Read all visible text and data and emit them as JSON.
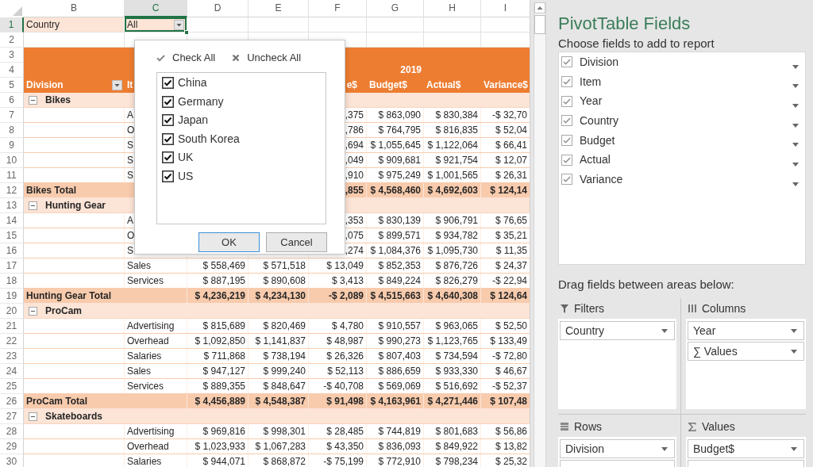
{
  "sheet": {
    "columns": [
      {
        "letter": "B",
        "selected": false
      },
      {
        "letter": "C",
        "selected": true
      },
      {
        "letter": "D",
        "selected": false
      },
      {
        "letter": "E",
        "selected": false
      },
      {
        "letter": "F",
        "selected": false
      },
      {
        "letter": "G",
        "selected": false
      },
      {
        "letter": "H",
        "selected": false
      },
      {
        "letter": "I",
        "selected": false
      }
    ],
    "rows": [
      {
        "number": "1",
        "selected": true,
        "kind": "filter",
        "cells": {
          "b": "Country",
          "c": "All"
        }
      },
      {
        "number": "2",
        "selected": false,
        "kind": "blank"
      },
      {
        "number": "3",
        "selected": false,
        "kind": "band"
      },
      {
        "number": "4",
        "selected": false,
        "kind": "band_years",
        "cells": {
          "g": "2019"
        }
      },
      {
        "number": "5",
        "selected": false,
        "kind": "band_labels",
        "filter_button": true,
        "cells": {
          "b": "Division",
          "c": "It",
          "f": "e$",
          "g": "Budget$",
          "h": "Actual$",
          "i": "Variance$"
        }
      },
      {
        "number": "6",
        "selected": false,
        "kind": "group",
        "expanded": true,
        "cells": {
          "b": "Bikes"
        }
      },
      {
        "number": "7",
        "selected": false,
        "kind": "item",
        "cells": {
          "c": "A",
          "f": ",375",
          "g": "$ 863,090",
          "h": "$ 830,384",
          "i": "-$ 32,70"
        }
      },
      {
        "number": "8",
        "selected": false,
        "kind": "item",
        "cells": {
          "c": "O",
          "f": ",786",
          "g": "$ 764,795",
          "h": "$ 816,835",
          "i": "$ 52,04"
        }
      },
      {
        "number": "9",
        "selected": false,
        "kind": "item",
        "cells": {
          "c": "S",
          "f": ",694",
          "g": "$ 1,055,645",
          "h": "$ 1,122,064",
          "i": "$ 66,41"
        }
      },
      {
        "number": "10",
        "selected": false,
        "kind": "item",
        "cells": {
          "c": "S",
          "f": ",049",
          "g": "$ 909,681",
          "h": "$ 921,754",
          "i": "$ 12,07"
        }
      },
      {
        "number": "11",
        "selected": false,
        "kind": "item",
        "cells": {
          "c": "S",
          "f": ",910",
          "g": "$ 975,249",
          "h": "$ 1,001,565",
          "i": "$ 26,31"
        }
      },
      {
        "number": "12",
        "selected": false,
        "kind": "total",
        "cells": {
          "b": "Bikes Total",
          "f": ",855",
          "g": "$ 4,568,460",
          "h": "$ 4,692,603",
          "i": "$ 124,14"
        }
      },
      {
        "number": "13",
        "selected": false,
        "kind": "group",
        "expanded": true,
        "cells": {
          "b": "Hunting Gear"
        }
      },
      {
        "number": "14",
        "selected": false,
        "kind": "item",
        "cells": {
          "c": "A",
          "f": ",353",
          "g": "$ 830,139",
          "h": "$ 906,791",
          "i": "$ 76,65"
        }
      },
      {
        "number": "15",
        "selected": false,
        "kind": "item",
        "cells": {
          "c": "O",
          "f": ",075",
          "g": "$ 899,571",
          "h": "$ 934,782",
          "i": "$ 35,21"
        }
      },
      {
        "number": "16",
        "selected": false,
        "kind": "item",
        "cells": {
          "c": "S",
          "f": ",274",
          "g": "$ 1,084,376",
          "h": "$ 1,095,730",
          "i": "$ 11,35"
        }
      },
      {
        "number": "17",
        "selected": false,
        "kind": "item",
        "cells": {
          "c": "Sales",
          "d": "$ 558,469",
          "e": "$ 571,518",
          "f": "$ 13,049",
          "g": "$ 852,353",
          "h": "$ 876,726",
          "i": "$ 24,37"
        }
      },
      {
        "number": "18",
        "selected": false,
        "kind": "item",
        "cells": {
          "c": "Services",
          "d": "$ 887,195",
          "e": "$ 890,608",
          "f": "$ 3,413",
          "g": "$ 849,224",
          "h": "$ 826,279",
          "i": "-$ 22,94"
        }
      },
      {
        "number": "19",
        "selected": false,
        "kind": "total",
        "cells": {
          "b": "Hunting Gear Total",
          "d": "$ 4,236,219",
          "e": "$ 4,234,130",
          "f": "-$ 2,089",
          "g": "$ 4,515,663",
          "h": "$ 4,640,308",
          "i": "$ 124,64"
        }
      },
      {
        "number": "20",
        "selected": false,
        "kind": "group",
        "expanded": true,
        "cells": {
          "b": "ProCam"
        }
      },
      {
        "number": "21",
        "selected": false,
        "kind": "item",
        "cells": {
          "c": "Advertising",
          "d": "$ 815,689",
          "e": "$ 820,469",
          "f": "$ 4,780",
          "g": "$ 910,557",
          "h": "$ 963,065",
          "i": "$ 52,50"
        }
      },
      {
        "number": "22",
        "selected": false,
        "kind": "item",
        "cells": {
          "c": "Overhead",
          "d": "$ 1,092,850",
          "e": "$ 1,141,837",
          "f": "$ 48,987",
          "g": "$ 990,273",
          "h": "$ 1,123,765",
          "i": "$ 133,49"
        }
      },
      {
        "number": "23",
        "selected": false,
        "kind": "item",
        "cells": {
          "c": "Salaries",
          "d": "$ 711,868",
          "e": "$ 738,194",
          "f": "$ 26,326",
          "g": "$ 807,403",
          "h": "$ 734,594",
          "i": "-$ 72,80"
        }
      },
      {
        "number": "24",
        "selected": false,
        "kind": "item",
        "cells": {
          "c": "Sales",
          "d": "$ 947,127",
          "e": "$ 999,240",
          "f": "$ 52,113",
          "g": "$ 886,659",
          "h": "$ 933,330",
          "i": "$ 46,67"
        }
      },
      {
        "number": "25",
        "selected": false,
        "kind": "item",
        "cells": {
          "c": "Services",
          "d": "$ 889,355",
          "e": "$ 848,647",
          "f": "-$ 40,708",
          "g": "$ 569,069",
          "h": "$ 516,692",
          "i": "-$ 52,37"
        }
      },
      {
        "number": "26",
        "selected": false,
        "kind": "total",
        "cells": {
          "b": "ProCam Total",
          "d": "$ 4,456,889",
          "e": "$ 4,548,387",
          "f": "$ 91,498",
          "g": "$ 4,163,961",
          "h": "$ 4,271,446",
          "i": "$ 107,48"
        }
      },
      {
        "number": "27",
        "selected": false,
        "kind": "group",
        "expanded": true,
        "cells": {
          "b": "Skateboards"
        }
      },
      {
        "number": "28",
        "selected": false,
        "kind": "item",
        "cells": {
          "c": "Advertising",
          "d": "$ 969,816",
          "e": "$ 998,301",
          "f": "$ 28,485",
          "g": "$ 744,819",
          "h": "$ 801,683",
          "i": "$ 56,86"
        }
      },
      {
        "number": "29",
        "selected": false,
        "kind": "item",
        "cells": {
          "c": "Overhead",
          "d": "$ 1,023,933",
          "e": "$ 1,067,283",
          "f": "$ 43,350",
          "g": "$ 836,093",
          "h": "$ 849,922",
          "i": "$ 13,82"
        }
      },
      {
        "number": "30",
        "selected": false,
        "kind": "item",
        "cells": {
          "c": "Salaries",
          "d": "$ 944,071",
          "e": "$ 868,872",
          "f": "-$ 75,199",
          "g": "$ 772,910",
          "h": "$ 798,234",
          "i": "$ 25,32"
        }
      }
    ]
  },
  "filter_popup": {
    "check_all": "Check All",
    "uncheck_all": "Uncheck All",
    "options": [
      {
        "label": "China",
        "checked": true
      },
      {
        "label": "Germany",
        "checked": true
      },
      {
        "label": "Japan",
        "checked": true
      },
      {
        "label": "South Korea",
        "checked": true
      },
      {
        "label": "UK",
        "checked": true
      },
      {
        "label": "US",
        "checked": true
      }
    ],
    "buttons": [
      {
        "label": "OK",
        "default": true
      },
      {
        "label": "Cancel",
        "default": false
      }
    ]
  },
  "field_list": {
    "title": "PivotTable Fields",
    "subtitle": "Choose fields to add to report",
    "fields": [
      {
        "label": "Division",
        "checked": true
      },
      {
        "label": "Item",
        "checked": true
      },
      {
        "label": "Year",
        "checked": true
      },
      {
        "label": "Country",
        "checked": true
      },
      {
        "label": "Budget",
        "checked": true
      },
      {
        "label": "Actual",
        "checked": true
      },
      {
        "label": "Variance",
        "checked": true
      }
    ],
    "areas_hint": "Drag fields between areas below:",
    "areas": [
      {
        "kind": "filters",
        "title": "Filters",
        "fields": [
          "Country"
        ]
      },
      {
        "kind": "columns",
        "title": "Columns",
        "fields": [
          "Year",
          "∑ Values"
        ]
      },
      {
        "kind": "rows",
        "title": "Rows",
        "fields": [
          "Division"
        ],
        "partial_chip": true
      },
      {
        "kind": "values",
        "title": "Values",
        "fields": [
          "Budget$"
        ],
        "partial_chip": true
      }
    ]
  }
}
